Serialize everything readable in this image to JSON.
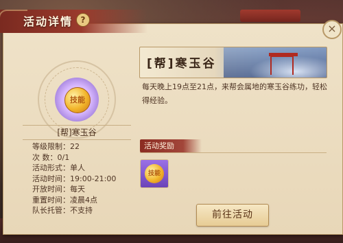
{
  "window": {
    "title": "活动详情",
    "help_label": "?",
    "close_label": "×"
  },
  "activity": {
    "emblem_text": "技能",
    "name": "[帮]寒玉谷",
    "info": [
      "等级限制：22",
      "次      数：0/1",
      "活动形式：单人",
      "活动时间：19:00-21:00",
      "开放时间：每天",
      "重置时间：凌晨4点",
      "队长托管：不支持"
    ]
  },
  "detail": {
    "banner_title": "[帮]寒玉谷",
    "description": "每天晚上19点至21点，来帮会属地的寒玉谷练功，轻松得经验。"
  },
  "rewards": {
    "tab_label": "活动奖励",
    "items": [
      {
        "icon": "skill-coin-icon",
        "text": "技能"
      }
    ]
  },
  "actions": {
    "go_label": "前往活动"
  },
  "colors": {
    "panel": "#efe2c8",
    "header": "#8b2c22",
    "reward_bg": "#7b55c8",
    "button": "#efdcb0"
  }
}
